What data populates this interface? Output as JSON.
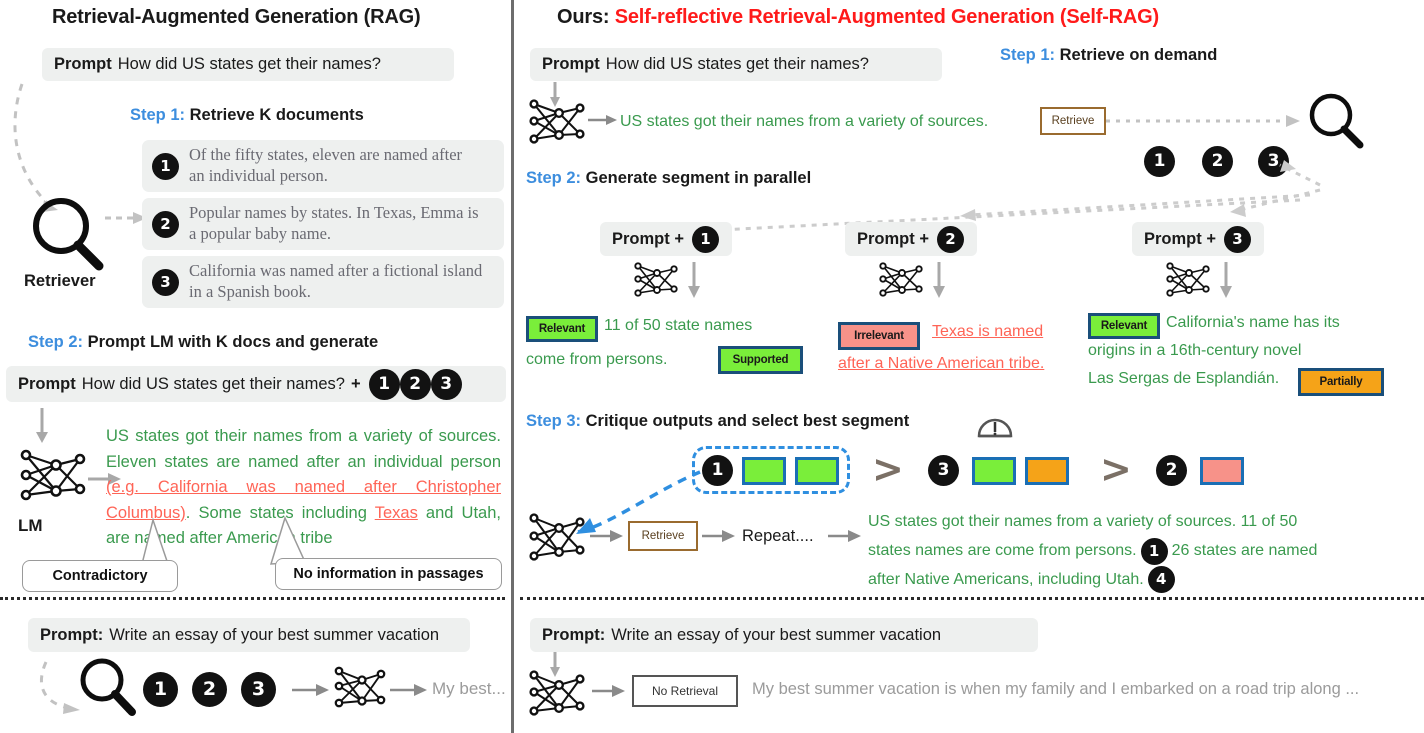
{
  "left_panel": {
    "title": "Retrieval-Augmented Generation (RAG)",
    "prompt": {
      "label": "Prompt",
      "text": "How did US states get their names?"
    },
    "step1": {
      "num": "Step 1:",
      "text": "Retrieve K documents"
    },
    "retriever_label": "Retriever",
    "documents": [
      {
        "id": "1",
        "text": "Of the fifty states, eleven are named after an individual person."
      },
      {
        "id": "2",
        "text": "Popular names by states. In Texas, Emma is a popular baby name."
      },
      {
        "id": "3",
        "text": "California was named after a fictional island in a Spanish book."
      }
    ],
    "step2": {
      "num": "Step 2:",
      "text": "Prompt LM with K docs and generate"
    },
    "prompt2": {
      "label": "Prompt",
      "text": "How did US states get their names?",
      "plus": "+",
      "docs": [
        "1",
        "2",
        "3"
      ]
    },
    "lm_label": "LM",
    "generation": {
      "seg1": "US states got their names from a variety of sources. Eleven states are named after an individual person ",
      "bad1": "(e.g. California was named after Christopher Columbus)",
      "seg2": ". Some states including ",
      "bad2": "Texas",
      "seg3": " and Utah, are named after American tribe"
    },
    "callouts": [
      {
        "text": "Contradictory"
      },
      {
        "text": "No information in passages"
      }
    ]
  },
  "right_panel": {
    "title_prefix": "Ours: ",
    "title_main": "Self-reflective Retrieval-Augmented Generation (Self-RAG)",
    "prompt": {
      "label": "Prompt",
      "text": "How did US states get their names?"
    },
    "step1": {
      "num": "Step 1:",
      "text": "Retrieve on demand"
    },
    "first_generation": "US states got their names from a variety of sources.",
    "retrieve_token": "Retrieve",
    "doc_ids": [
      "1",
      "2",
      "3"
    ],
    "step2": {
      "num": "Step 2:",
      "text": "Generate segment in parallel"
    },
    "columns": [
      {
        "header_label": "Prompt +",
        "doc_id": "1",
        "relevance_token": "Relevant",
        "text_line1": "11 of 50 state names",
        "text_line2": "come from persons.",
        "support_token": "Supported"
      },
      {
        "header_label": "Prompt +",
        "doc_id": "2",
        "relevance_token": "Irrelevant",
        "text_line1": "Texas is named",
        "text_line2": "after a Native American tribe.",
        "support_token": ""
      },
      {
        "header_label": "Prompt +",
        "doc_id": "3",
        "relevance_token": "Relevant",
        "text_line1": "California's name has its",
        "text_line2": "origins  in  a  16th-century  novel",
        "text_line3": "Las Sergas de Esplandián.",
        "support_token": "Partially"
      }
    ],
    "step3": {
      "num": "Step 3:",
      "text": "Critique outputs and select best segment"
    },
    "ranking": [
      {
        "doc_id": "1",
        "boxes": [
          "green",
          "green"
        ],
        "selected": true
      },
      {
        "doc_id": "3",
        "boxes": [
          "green",
          "orange"
        ],
        "selected": false
      },
      {
        "doc_id": "2",
        "boxes": [
          "red"
        ],
        "selected": false
      }
    ],
    "gt_symbol": ">",
    "final_flow": {
      "retrieve_token": "Retrieve",
      "repeat_label": "Repeat....",
      "answer_l1": "US states got their names from a variety of sources. 11 of 50",
      "answer_l2a": "states names are come from persons.",
      "answer_l2_cite": "1",
      "answer_l2b": "26 states are named",
      "answer_l3": "after Native Americans, including Utah.",
      "answer_l3_cite": "4"
    }
  },
  "bottom_left": {
    "prompt": {
      "label": "Prompt:",
      "text": "Write an essay of your best summer vacation"
    },
    "doc_ids": [
      "1",
      "2",
      "3"
    ],
    "output": "My best..."
  },
  "bottom_right": {
    "prompt": {
      "label": "Prompt:",
      "text": "Write an essay of your best summer vacation"
    },
    "no_retrieval_token": "No Retrieval",
    "output": "My best summer vacation is when my family and I embarked on a road trip along ..."
  },
  "colors": {
    "step_blue": "#3d8ede",
    "title_red": "#ff1a1a",
    "generated_green": "#3a9a4e",
    "error_red": "#ff6456",
    "token_green": "#7aee3a",
    "token_red": "#f79289",
    "token_orange": "#f5a318",
    "token_border": "#1a4f7a",
    "retrieve_border": "#9a6b2f",
    "select_blue": "#2f8fe0"
  }
}
